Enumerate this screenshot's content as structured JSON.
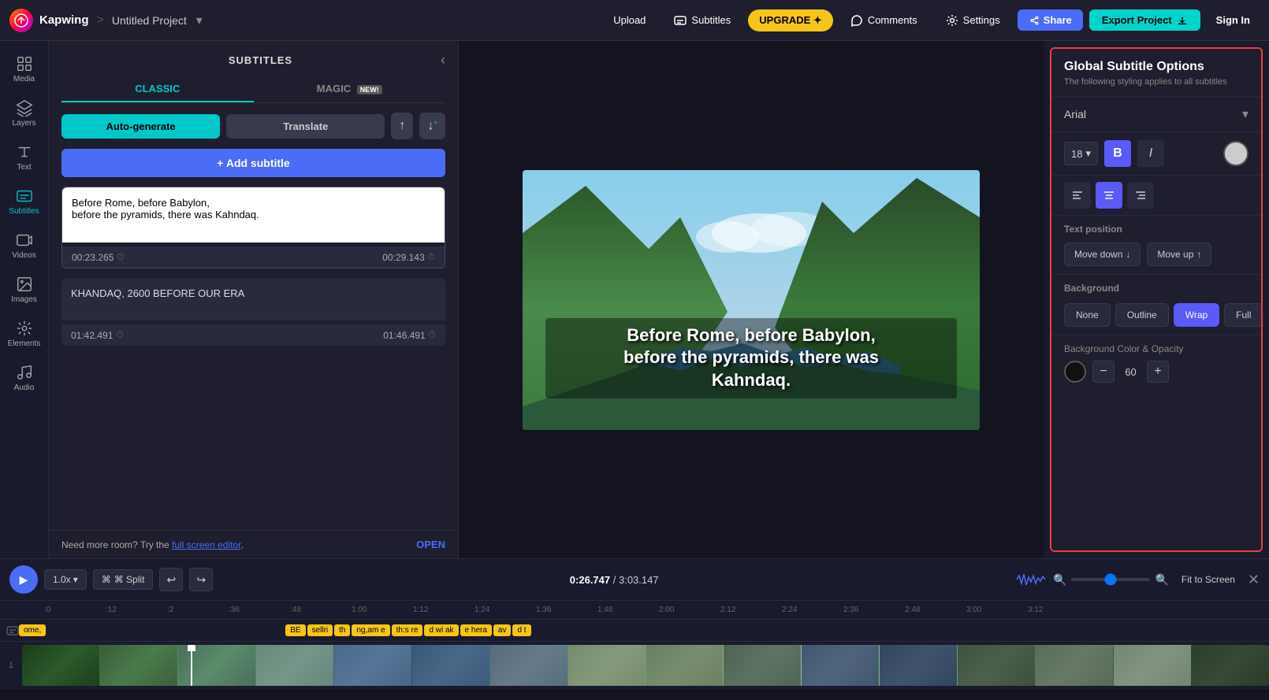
{
  "app": {
    "logo_text": "K",
    "brand": "Kapwing",
    "separator": ">",
    "project_name": "Untitled Project",
    "nav": {
      "upload": "Upload",
      "subtitles": "Subtitles",
      "upgrade": "UPGRADE ✦",
      "comments": "Comments",
      "settings": "Settings",
      "share": "Share",
      "export": "Export Project",
      "signin": "Sign In"
    }
  },
  "sidebar": {
    "items": [
      {
        "id": "media",
        "label": "Media",
        "icon": "grid"
      },
      {
        "id": "layers",
        "label": "Layers",
        "icon": "layers"
      },
      {
        "id": "text",
        "label": "Text",
        "icon": "text"
      },
      {
        "id": "subtitles",
        "label": "Subtitles",
        "icon": "cc",
        "active": true
      },
      {
        "id": "videos",
        "label": "Videos",
        "icon": "video"
      },
      {
        "id": "images",
        "label": "Images",
        "icon": "image"
      },
      {
        "id": "elements",
        "label": "Elements",
        "icon": "elements"
      },
      {
        "id": "audio",
        "label": "Audio",
        "icon": "music"
      }
    ]
  },
  "subtitles_panel": {
    "title": "SUBTITLES",
    "tabs": [
      {
        "id": "classic",
        "label": "CLASSIC",
        "active": true
      },
      {
        "id": "magic",
        "label": "MAGIC",
        "badge": "NEW!"
      }
    ],
    "actions": {
      "autogenerate": "Auto-generate",
      "translate": "Translate"
    },
    "add_subtitle": "+ Add subtitle",
    "cards": [
      {
        "id": 1,
        "text": "Before Rome, before Babylon,\nbefore the pyramids, there was Kahndaq.",
        "start": "00:23.265",
        "end": "00:29.143",
        "active": true
      },
      {
        "id": 2,
        "text": "KHANDAQ, 2600 BEFORE OUR ERA",
        "start": "01:42.491",
        "end": "01:46.491",
        "active": false
      }
    ],
    "more_room": "Need more room? Try the",
    "more_room_link": "full screen editor",
    "more_room_suffix": ".",
    "open_btn": "OPEN"
  },
  "video_preview": {
    "subtitle_text": "Before Rome, before Babylon,\nbefore the pyramids, there was\nKahndaq."
  },
  "global_subtitle_options": {
    "title": "Global Subtitle Options",
    "subtitle": "The following styling applies to all subtitles",
    "font": "Arial",
    "font_size": "18",
    "bold": "B",
    "italic": "I",
    "text_position_label": "Text position",
    "move_down": "Move down",
    "move_up": "Move up",
    "background_label": "Background",
    "bg_options": [
      "None",
      "Outline",
      "Wrap",
      "Full"
    ],
    "bg_active": "Wrap",
    "bg_color_label": "Background Color & Opacity",
    "opacity_value": "60"
  },
  "timeline": {
    "play_btn": "▶",
    "speed": "1.0x",
    "split": "⌘ Split",
    "time_current": "0:26.747",
    "time_separator": " / ",
    "time_total": "3:03.147",
    "fit_to_screen": "Fit to Screen",
    "ruler_marks": [
      ":0",
      ":12",
      ":2",
      ":36",
      ":48",
      "1:00",
      "1:12",
      "1:24",
      "1:36",
      "1:48",
      "2:00",
      "2:12",
      "2:24",
      "2:36",
      "2:48",
      "3:00",
      "3:12"
    ],
    "track_number": "1",
    "subtitle_chips": [
      "ome,",
      "BE",
      "sellri",
      "th",
      "ng,am e",
      "th:s re",
      "d wi ak",
      "e hera",
      "av",
      "d t"
    ]
  }
}
